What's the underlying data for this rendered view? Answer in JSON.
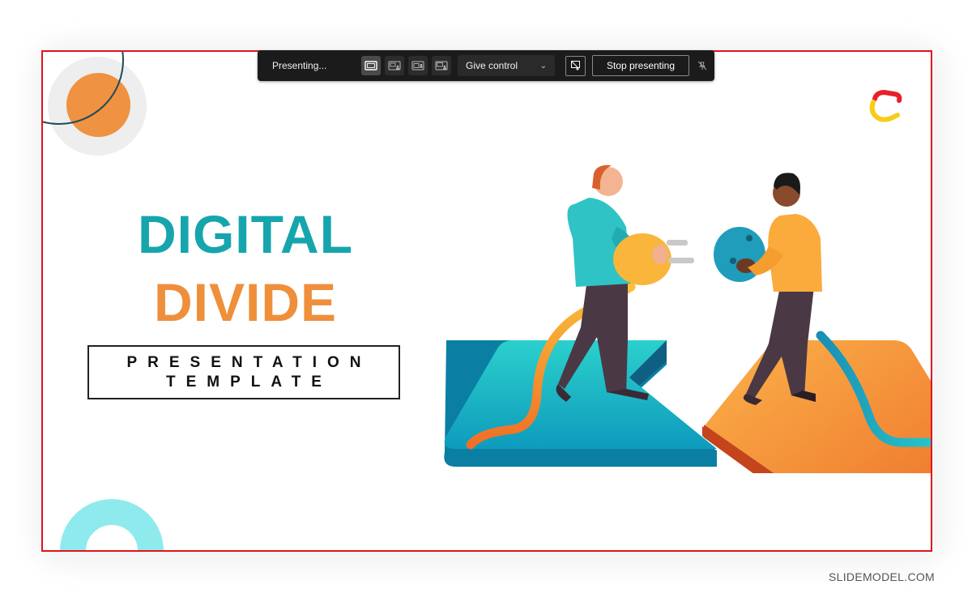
{
  "toolbar": {
    "status": "Presenting...",
    "layouts": [
      {
        "name": "content-only",
        "active": true
      },
      {
        "name": "standout",
        "active": false
      },
      {
        "name": "side-by-side",
        "active": false
      },
      {
        "name": "reporter",
        "active": false
      }
    ],
    "give_control_label": "Give control",
    "stop_presenting_label": "Stop presenting"
  },
  "slide": {
    "title_line1": "DIGITAL",
    "title_line2": "DIVIDE",
    "subtitle_line1": "PRESENTATION",
    "subtitle_line2": "TEMPLATE",
    "colors": {
      "teal": "#16a5ac",
      "orange": "#ef8f3b",
      "border": "#e0141e",
      "light_teal": "#8feaee"
    }
  },
  "watermark": "SLIDEMODEL.COM"
}
